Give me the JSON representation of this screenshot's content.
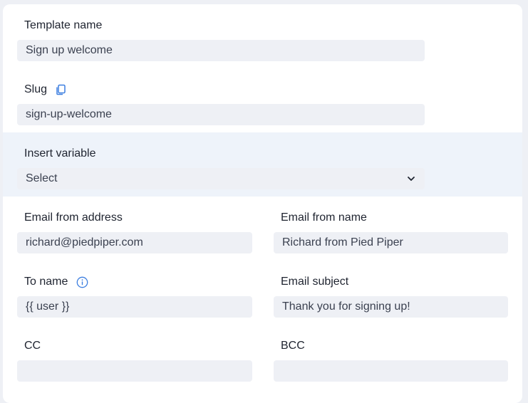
{
  "form": {
    "template_name": {
      "label": "Template name",
      "value": "Sign up welcome"
    },
    "slug": {
      "label": "Slug",
      "value": "sign-up-welcome",
      "copy_icon": "copy-icon"
    },
    "insert_variable": {
      "label": "Insert variable",
      "value": "Select",
      "chevron_icon": "chevron-down-icon"
    },
    "email_from_address": {
      "label": "Email from address",
      "value": "richard@piedpiper.com"
    },
    "email_from_name": {
      "label": "Email from name",
      "value": "Richard from Pied Piper"
    },
    "to_name": {
      "label": "To name",
      "value": "{{ user }}",
      "info_icon": "info-icon"
    },
    "email_subject": {
      "label": "Email subject",
      "value": "Thank you for signing up!"
    },
    "cc": {
      "label": "CC",
      "value": ""
    },
    "bcc": {
      "label": "BCC",
      "value": ""
    }
  },
  "colors": {
    "accent": "#3d7fe0",
    "field_bg": "#eef0f5",
    "highlight_bg": "#eef3fa"
  }
}
